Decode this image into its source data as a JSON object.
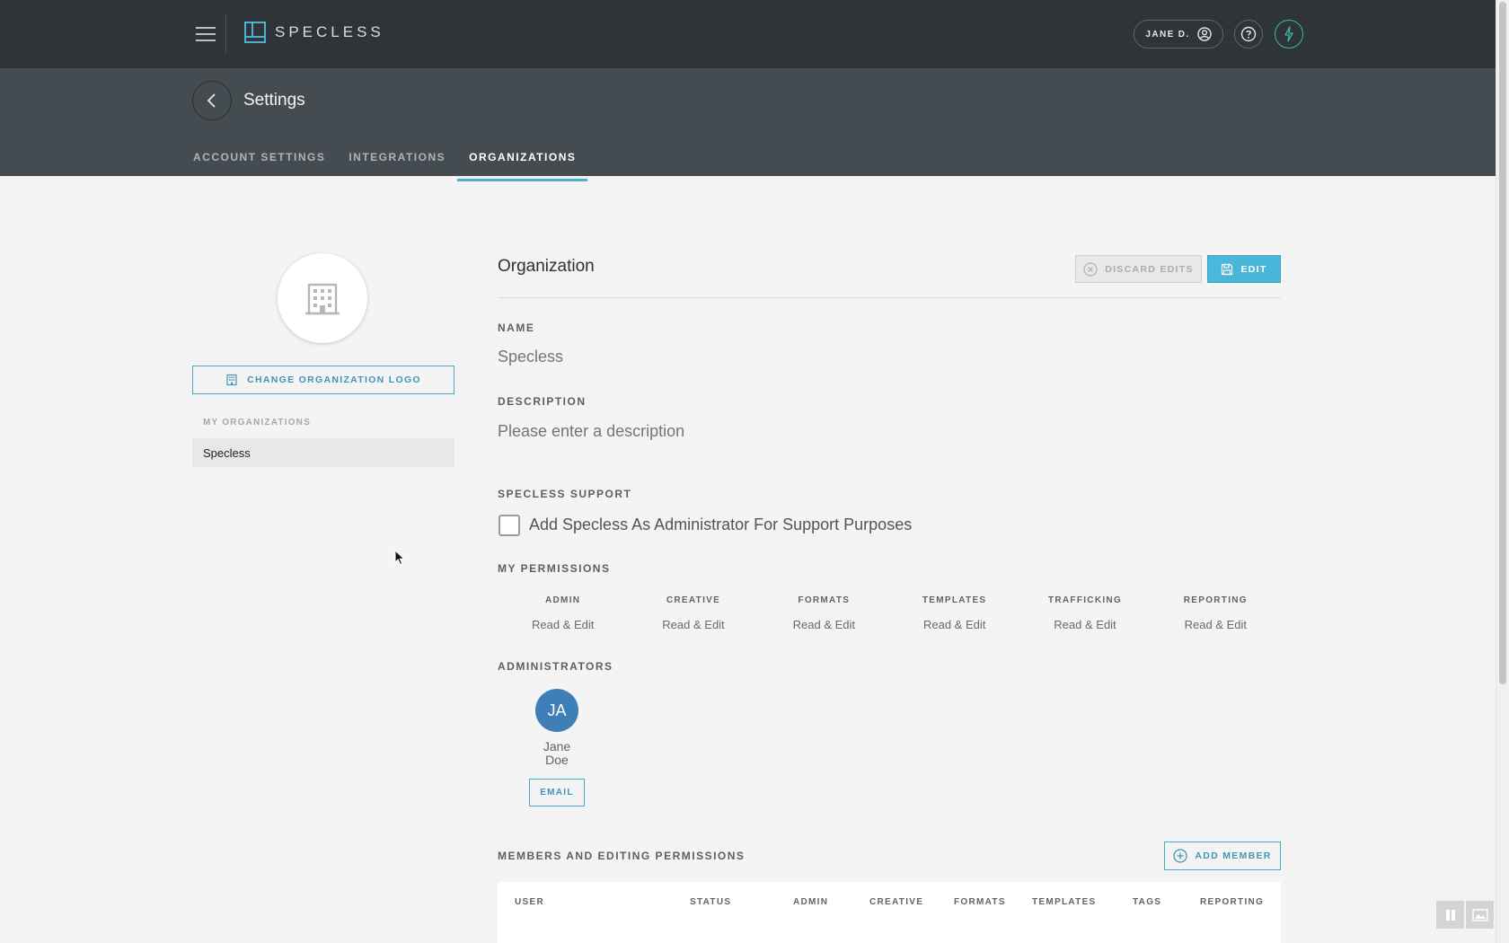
{
  "app": {
    "name": "SPECLESS",
    "user_label": "JANE D."
  },
  "header": {
    "title": "Settings",
    "tabs": [
      {
        "label": "ACCOUNT SETTINGS",
        "active": false
      },
      {
        "label": "INTEGRATIONS",
        "active": false
      },
      {
        "label": "ORGANIZATIONS",
        "active": true
      }
    ]
  },
  "sidebar": {
    "change_logo_label": "CHANGE ORGANIZATION LOGO",
    "my_orgs_label": "MY ORGANIZATIONS",
    "orgs": [
      "Specless"
    ]
  },
  "organization": {
    "title": "Organization",
    "discard_label": "DISCARD EDITS",
    "edit_label": "EDIT",
    "name_label": "NAME",
    "name_value": "Specless",
    "description_label": "DESCRIPTION",
    "description_placeholder": "Please enter a description",
    "support_label": "SPECLESS SUPPORT",
    "support_checkbox_label": "Add Specless As Administrator For Support Purposes",
    "support_checked": false,
    "permissions_label": "MY PERMISSIONS",
    "permissions": [
      {
        "name": "ADMIN",
        "value": "Read & Edit"
      },
      {
        "name": "CREATIVE",
        "value": "Read & Edit"
      },
      {
        "name": "FORMATS",
        "value": "Read & Edit"
      },
      {
        "name": "TEMPLATES",
        "value": "Read & Edit"
      },
      {
        "name": "TRAFFICKING",
        "value": "Read & Edit"
      },
      {
        "name": "REPORTING",
        "value": "Read & Edit"
      }
    ],
    "administrators_label": "ADMINISTRATORS",
    "administrators": [
      {
        "initials": "JA",
        "first": "Jane",
        "last": "Doe",
        "email_label": "EMAIL"
      }
    ],
    "members_label": "MEMBERS AND EDITING PERMISSIONS",
    "add_member_label": "ADD MEMBER",
    "members_columns": [
      "USER",
      "STATUS",
      "ADMIN",
      "CREATIVE",
      "FORMATS",
      "TEMPLATES",
      "TAGS",
      "REPORTING"
    ]
  },
  "colors": {
    "accent": "#4ab6d9",
    "topbar": "#2f3438",
    "subheader": "#454c51",
    "avatar": "#3d7fb6"
  }
}
